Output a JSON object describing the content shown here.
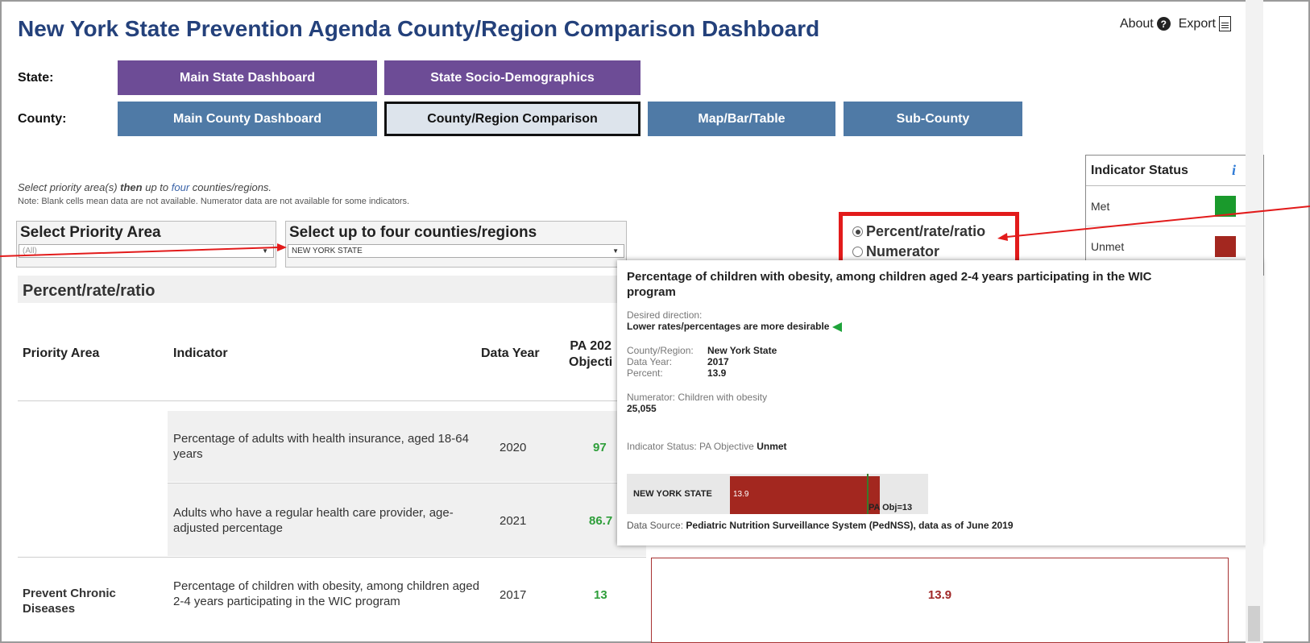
{
  "header": {
    "title": "New York State Prevention Agenda County/Region Comparison Dashboard",
    "about": "About",
    "export": "Export"
  },
  "nav": {
    "state_label": "State:",
    "county_label": "County:",
    "state_buttons": [
      "Main State Dashboard",
      "State Socio-Demographics"
    ],
    "county_buttons": [
      "Main County Dashboard",
      "County/Region Comparison",
      "Map/Bar/Table",
      "Sub-County"
    ],
    "active": "County/Region Comparison"
  },
  "legend": {
    "title": "Indicator Status",
    "info": "i",
    "items": [
      {
        "label": "Met",
        "color": "#1a9a2c"
      },
      {
        "label": "Unmet",
        "color": "#a3271f"
      }
    ]
  },
  "instructions": {
    "part1": "Select priority area(s) ",
    "then": "then",
    "part2": " up to ",
    "four": "four",
    "part3": " counties/regions.",
    "note": "Note: Blank cells mean data are not available. Numerator data are not available for some indicators."
  },
  "filters": {
    "priority_label": "Select Priority Area",
    "priority_value": "(All)",
    "counties_label": "Select up to four counties/regions",
    "counties_value": "NEW YORK STATE"
  },
  "display_mode": {
    "options": [
      "Percent/rate/ratio",
      "Numerator"
    ],
    "selected": "Percent/rate/ratio"
  },
  "section_title": "Percent/rate/ratio",
  "table": {
    "headers": {
      "priority_area": "Priority Area",
      "indicator": "Indicator",
      "data_year": "Data Year",
      "pa_objective": "PA 202\nObjecti"
    },
    "rows": [
      {
        "priority_area": "",
        "indicator": "Percentage of adults with health insurance, aged 18-64 years",
        "year": "2020",
        "objective": "97"
      },
      {
        "priority_area": "",
        "indicator": "Adults who have a regular health care provider, age-adjusted percentage",
        "year": "2021",
        "objective": "86.7"
      },
      {
        "priority_area": "Prevent Chronic Diseases",
        "indicator": "Percentage of children with obesity, among children aged 2-4 years participating in the WIC program",
        "year": "2017",
        "objective": "13",
        "value": "13.9"
      }
    ]
  },
  "tooltip": {
    "title": "Percentage of children with obesity, among children aged 2-4 years participating in the WIC program",
    "direction_label": "Desired direction:",
    "direction_value": "Lower rates/percentages are more desirable",
    "region_key": "County/Region:",
    "region_val": "New York State",
    "year_key": "Data Year:",
    "year_val": "2017",
    "percent_key": "Percent:",
    "percent_val": "13.9",
    "numerator_label": "Numerator: Children with obesity",
    "numerator_val": "25,055",
    "status_prefix": "Indicator Status: PA Objective",
    "status_val": "Unmet",
    "bar_label": "NEW YORK STATE",
    "bar_value": "13.9",
    "objective_label": "PA Obj=13",
    "source_prefix": "Data Source:",
    "source_val": "Pediatric Nutrition Surveillance System (PedNSS), data as of June 2019"
  }
}
